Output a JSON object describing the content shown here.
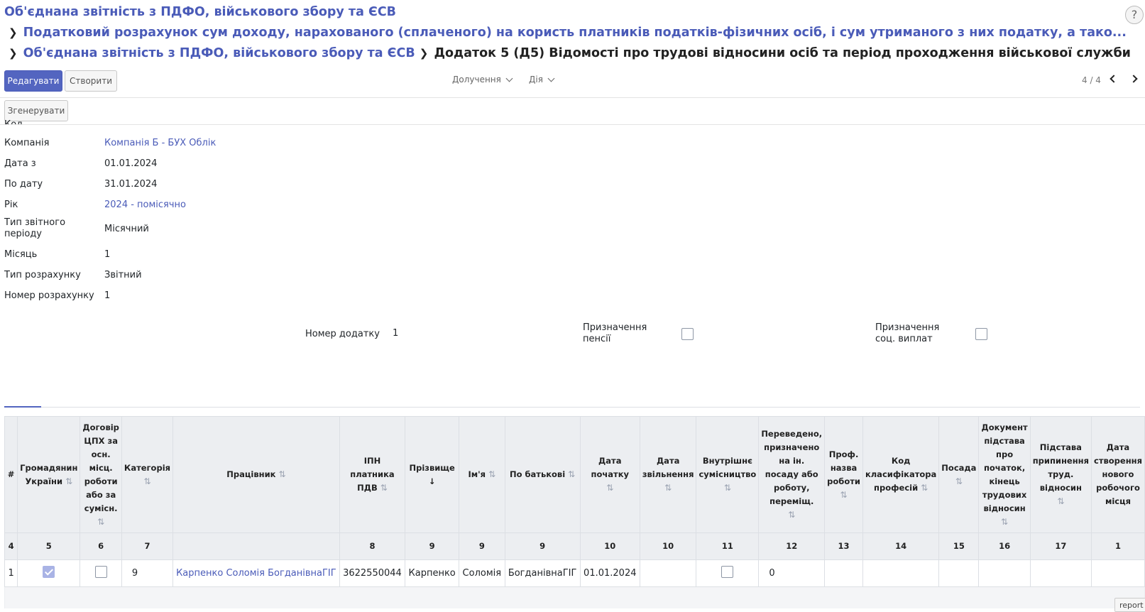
{
  "breadcrumb": {
    "level1": "Об'єднана звітність з ПДФО, військового збору та ЄСВ",
    "level2": "Податковий розрахунок сум доходу, нарахованого (сплаченого) на користь платників податків-фізичних осіб, і сум утриманого з них податку, а тако...",
    "level3": "Об'єднана звітність з ПДФО, військового збору та ЄСВ",
    "current": "Додаток 5 (Д5) Відомості про трудові відносини осіб та період проходження військової служби"
  },
  "help_label": "?",
  "toolbar": {
    "edit_label": "Редагувати",
    "create_label": "Створити",
    "attachment_label": "Долучення",
    "action_label": "Дія",
    "pager": "4 / 4",
    "generate_label": "Згенерувати"
  },
  "form": {
    "partial_label": "Код",
    "fields": [
      {
        "label": "Компанія",
        "value": "Компанія Б - БУХ Облік"
      },
      {
        "label": "Дата з",
        "value": "01.01.2024"
      },
      {
        "label": "По дату",
        "value": "31.01.2024"
      },
      {
        "label": "Рік",
        "value": "2024 - помісячно"
      },
      {
        "label": "Тип звітного періоду",
        "value": "Місячний"
      },
      {
        "label": "Місяць",
        "value": "1"
      },
      {
        "label": "Тип розрахунку",
        "value": "Звітний"
      },
      {
        "label": "Номер розрахунку",
        "value": "1"
      }
    ],
    "appendix_number_label": "Номер додатку",
    "appendix_number_value": "1",
    "pension_label": "Призначення пенсії",
    "pension_checked": false,
    "social_label": "Призначення соц. виплат",
    "social_checked": false
  },
  "table": {
    "columns": [
      {
        "header": "#",
        "num": "4"
      },
      {
        "header": "Громадянин України",
        "num": "5"
      },
      {
        "header": "Договір ЦПХ за осн. місц. роботи або за сумісн.",
        "num": "6"
      },
      {
        "header": "Категорія",
        "num": "7"
      },
      {
        "header": "Працівник",
        "num": ""
      },
      {
        "header": "ІПН платника ПДВ",
        "num": "8"
      },
      {
        "header": "Прізвище",
        "num": "9"
      },
      {
        "header": "Ім'я",
        "num": "9"
      },
      {
        "header": "По батькові",
        "num": "9"
      },
      {
        "header": "Дата початку",
        "num": "10"
      },
      {
        "header": "Дата звільнення",
        "num": "10"
      },
      {
        "header": "Внутрішнє сумісництво",
        "num": "11"
      },
      {
        "header": "Переведено, призначено на ін. посаду або роботу, переміщ.",
        "num": "12"
      },
      {
        "header": "Проф. назва роботи",
        "num": "13"
      },
      {
        "header": "Код класифікатора професій",
        "num": "14"
      },
      {
        "header": "Посада",
        "num": "15"
      },
      {
        "header": "Документ підстава про початок, кінець трудових відносин",
        "num": "16"
      },
      {
        "header": "Підстава припинення труд. відносин",
        "num": "17"
      },
      {
        "header": "Дата створення нового робочого місця",
        "num": "1"
      }
    ],
    "rows": [
      {
        "index": "1",
        "citizen": true,
        "gph": false,
        "category": "9",
        "employee": "Карпенко Соломія БогданівнаГІГ",
        "ipn": "3622550044",
        "surname": "Карпенко",
        "name": "Соломія",
        "patronymic": "БогданівнаГІГ",
        "start_date": "01.01.2024",
        "end_date": "",
        "internal": false,
        "transferred": "0",
        "prof_name": "",
        "prof_code": "",
        "position": "",
        "doc_basis": "",
        "termination": "",
        "new_job_date": ""
      }
    ]
  },
  "report_badge": "report c"
}
